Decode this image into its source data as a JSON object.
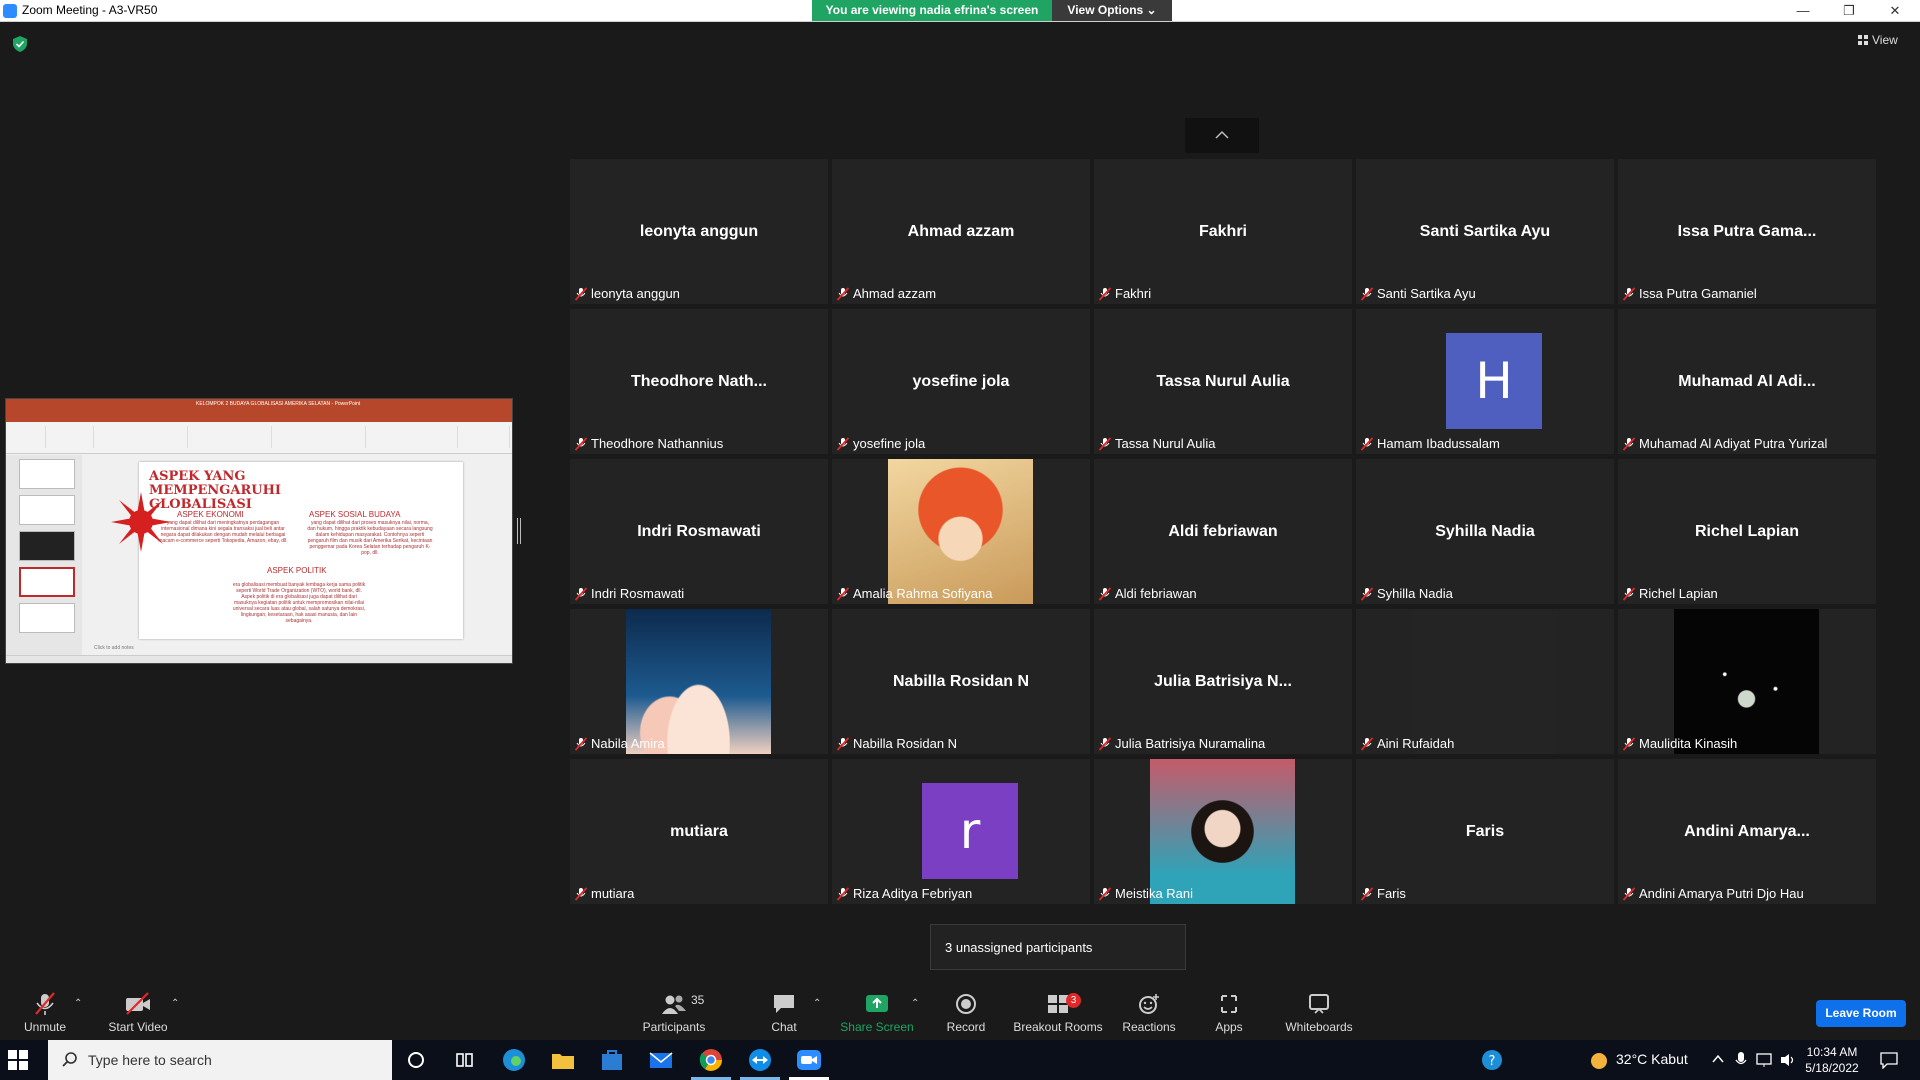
{
  "window": {
    "title": "Zoom Meeting - A3-VR50",
    "viewing_banner": "You are viewing nadia efrina's screen",
    "view_options": "View Options ⌄",
    "minimize": "—",
    "restore": "❐",
    "close": "✕"
  },
  "meeting": {
    "view_label": "View",
    "security_color": "#1fa463"
  },
  "shared_screen": {
    "app_title": "KELOMPOK 2 BUDAYA GLOBALISASI AMERIKA SELATAN - PowerPoint",
    "slide_title": "ASPEK YANG MEMPENGARUHI GLOBALISASI",
    "heading_ekonomi": "ASPEK EKONOMI",
    "text_ekonomi": "yang dapat dilihat dari meningkatnya perdagangan internasional dimana kini segala transaksi jual beli antar negara dapat dilakukan dengan mudah melalui berbagai macam e-commerce seperti Tokopedia, Amazon, ebay, dll.",
    "heading_sosial": "ASPEK SOSIAL BUDAYA",
    "text_sosial": "yang dapat dilihat dari proses masuknya nilai, norma, dan hukum, hingga praktik kebudayaan secara langsung dalam kehidupan masyarakat. Contohnya seperti pengaruh film dan musik dari Amerika Serikat, kecintaan penggemar pada Korea Selatan terhadap pengaruh K-pop, dll.",
    "heading_politik": "ASPEK POLITIK",
    "text_politik": "era globalisasi membuat banyak lembaga kerja sama politik seperti World Trade Organization (WTO), world bank, dll. Aspek politik di era globalisasi juga dapat dilihat dari masuknya kegiatan politik untuk mempromosikan nilai-nilai universal secara luas atau global, salah satunya demokrasi, lingkungan, kesetaraan, hak asasi manusia, dan lain sebagainya.",
    "notes_placeholder": "Click to add notes",
    "accent": "#c0282c"
  },
  "participants": [
    {
      "display": "leonyta anggun",
      "label": "leonyta anggun"
    },
    {
      "display": "Ahmad azzam",
      "label": "Ahmad azzam"
    },
    {
      "display": "Fakhri",
      "label": "Fakhri"
    },
    {
      "display": "Santi Sartika Ayu",
      "label": "Santi Sartika Ayu"
    },
    {
      "display": "Issa Putra Gama...",
      "label": "Issa Putra Gamaniel"
    },
    {
      "display": "Theodhore  Nath...",
      "label": "Theodhore Nathannius"
    },
    {
      "display": "yosefine jola",
      "label": "yosefine jola"
    },
    {
      "display": "Tassa Nurul Aulia",
      "label": "Tassa Nurul Aulia"
    },
    {
      "display": "H",
      "label": "Hamam Ibadussalam",
      "avatar_color": "#4f5fc0"
    },
    {
      "display": "Muhamad  Al Adi...",
      "label": "Muhamad Al Adiyat Putra Yurizal"
    },
    {
      "display": "Indri Rosmawati",
      "label": "Indri Rosmawati"
    },
    {
      "display": "",
      "label": "Amalia Rahma Sofiyana",
      "photo": "anime-fox"
    },
    {
      "display": "Aldi febriawan",
      "label": "Aldi febriawan"
    },
    {
      "display": "Syhilla Nadia",
      "label": "Syhilla Nadia"
    },
    {
      "display": "Richel Lapian",
      "label": "Richel Lapian"
    },
    {
      "display": "",
      "label": "Nabila Amira",
      "photo": "ladder-clouds"
    },
    {
      "display": "Nabilla Rosidan N",
      "label": "Nabilla Rosidan N"
    },
    {
      "display": "Julia Batrisiya N...",
      "label": "Julia Batrisiya Nuramalina"
    },
    {
      "display": "",
      "label": "Aini Rufaidah",
      "photo": "dark"
    },
    {
      "display": "",
      "label": "Maulidita Kinasih",
      "photo": "sparkle-hand"
    },
    {
      "display": "mutiara",
      "label": "mutiara"
    },
    {
      "display": "r",
      "label": "Riza Aditya Febriyan",
      "avatar_color": "#7b3fc4"
    },
    {
      "display": "",
      "label": "Meistika Rani",
      "photo": "selfie"
    },
    {
      "display": "Faris",
      "label": "Faris"
    },
    {
      "display": "Andini  Amarya...",
      "label": "Andini Amarya Putri Djo Hau"
    }
  ],
  "tooltip": "3 unassigned participants",
  "toolbar": {
    "unmute": "Unmute",
    "start_video": "Start Video",
    "participants": "Participants",
    "participants_count": "35",
    "chat": "Chat",
    "share_screen": "Share Screen",
    "record": "Record",
    "breakout_rooms": "Breakout Rooms",
    "breakout_badge": "3",
    "reactions": "Reactions",
    "apps": "Apps",
    "whiteboards": "Whiteboards",
    "leave": "Leave Room",
    "share_color": "#1fa463",
    "leave_color": "#0e71eb"
  },
  "taskbar": {
    "search_placeholder": "Type here to search",
    "weather": "32°C  Kabut",
    "time": "10:34 AM",
    "date": "5/18/2022"
  }
}
